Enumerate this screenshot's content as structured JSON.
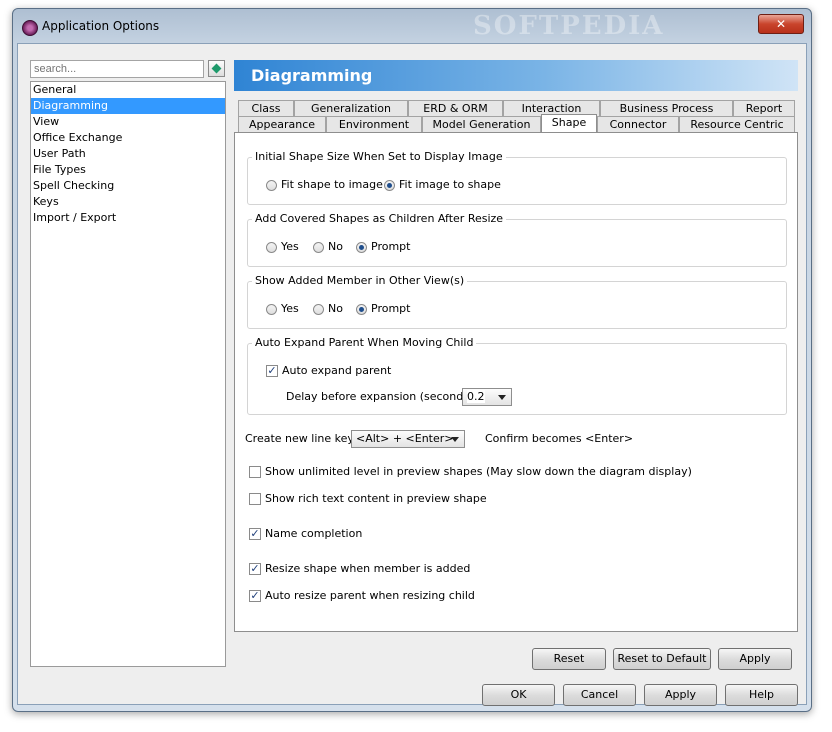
{
  "window": {
    "title": "Application Options",
    "watermark": "SOFTPEDIA",
    "close_glyph": "✕"
  },
  "search": {
    "placeholder": "search..."
  },
  "tree": {
    "items": [
      {
        "label": "General",
        "selected": false
      },
      {
        "label": "Diagramming",
        "selected": true
      },
      {
        "label": "View",
        "selected": false
      },
      {
        "label": "Office Exchange",
        "selected": false
      },
      {
        "label": "User Path",
        "selected": false
      },
      {
        "label": "File Types",
        "selected": false
      },
      {
        "label": "Spell Checking",
        "selected": false
      },
      {
        "label": "Keys",
        "selected": false
      },
      {
        "label": "Import / Export",
        "selected": false
      }
    ]
  },
  "header": {
    "title": "Diagramming"
  },
  "tabs": {
    "row1": [
      "Class",
      "Generalization",
      "ERD & ORM",
      "Interaction",
      "Business Process",
      "Report"
    ],
    "row2": [
      "Appearance",
      "Environment",
      "Model Generation",
      "Shape",
      "Connector",
      "Resource Centric"
    ],
    "active": "Shape"
  },
  "groups": {
    "initial_shape": {
      "legend": "Initial Shape Size When Set to Display Image",
      "options": [
        "Fit shape to image",
        "Fit image to shape"
      ],
      "selected": "Fit image to shape"
    },
    "covered_shapes": {
      "legend": "Add Covered Shapes as Children After Resize",
      "options": [
        "Yes",
        "No",
        "Prompt"
      ],
      "selected": "Prompt"
    },
    "show_added_member": {
      "legend": "Show Added Member in Other View(s)",
      "options": [
        "Yes",
        "No",
        "Prompt"
      ],
      "selected": "Prompt"
    },
    "auto_expand": {
      "legend": "Auto Expand Parent When Moving Child",
      "checkbox_label": "Auto expand parent",
      "checked": true,
      "delay_label": "Delay before expansion (seconds) :",
      "delay_value": "0.2"
    }
  },
  "newline": {
    "label": "Create new line key :",
    "value": "<Alt> + <Enter>",
    "confirm_text": "Confirm becomes <Enter>"
  },
  "checkboxes": [
    {
      "label": "Show unlimited level in preview shapes (May slow down the diagram display)",
      "checked": false
    },
    {
      "label": "Show rich text content in preview shape",
      "checked": false
    },
    {
      "label": "Name completion",
      "checked": true
    },
    {
      "label": "Resize shape when member is added",
      "checked": true
    },
    {
      "label": "Auto resize parent when resizing child",
      "checked": true
    }
  ],
  "panel_buttons": {
    "reset": "Reset",
    "reset_default": "Reset to Default",
    "apply": "Apply"
  },
  "dialog_buttons": {
    "ok": "OK",
    "cancel": "Cancel",
    "apply": "Apply",
    "help": "Help"
  },
  "icons": {
    "app": "app-logo-icon",
    "search_go": "search-go-icon",
    "close": "close-icon",
    "check_glyph": "✓"
  }
}
